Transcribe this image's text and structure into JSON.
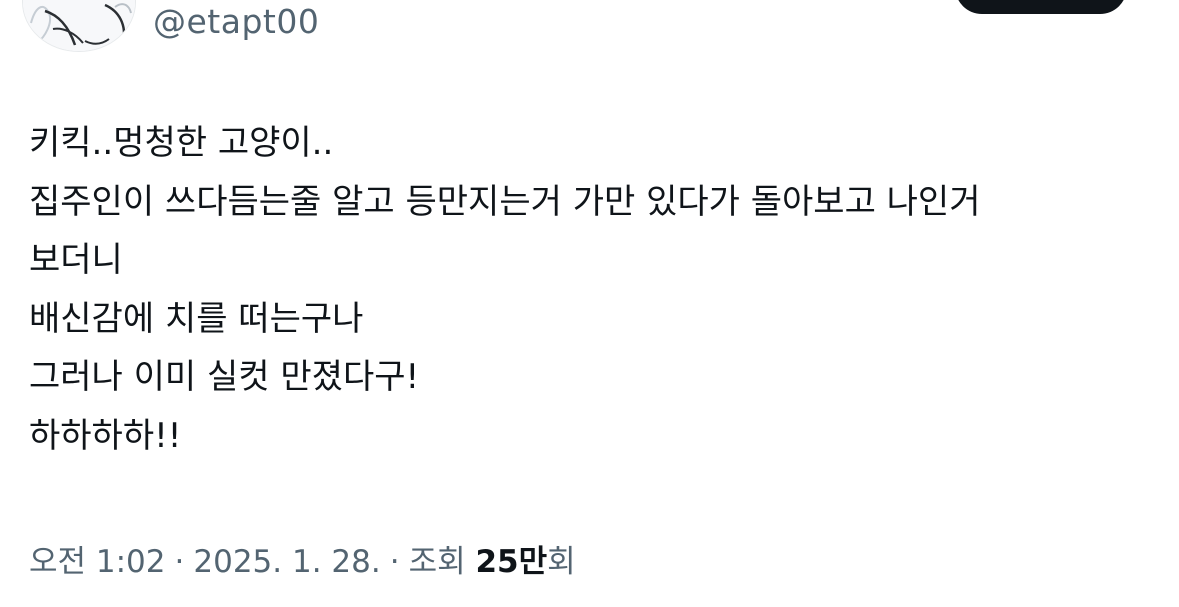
{
  "author": {
    "handle": "@etapt00"
  },
  "tweet": {
    "lines": [
      "키킥..멍청한 고양이..",
      "집주인이 쓰다듬는줄 알고 등만지는거 가만 있다가 돌아보고 나인거",
      "보더니",
      "배신감에 치를 떠는구나",
      "그러나 이미 실컷 만졌다구!",
      "하하하하!!"
    ]
  },
  "meta": {
    "time": "오전 1:02",
    "separator": "·",
    "date": "2025. 1. 28.",
    "views_label": "조회",
    "views_count": "25만",
    "views_suffix": "회"
  }
}
